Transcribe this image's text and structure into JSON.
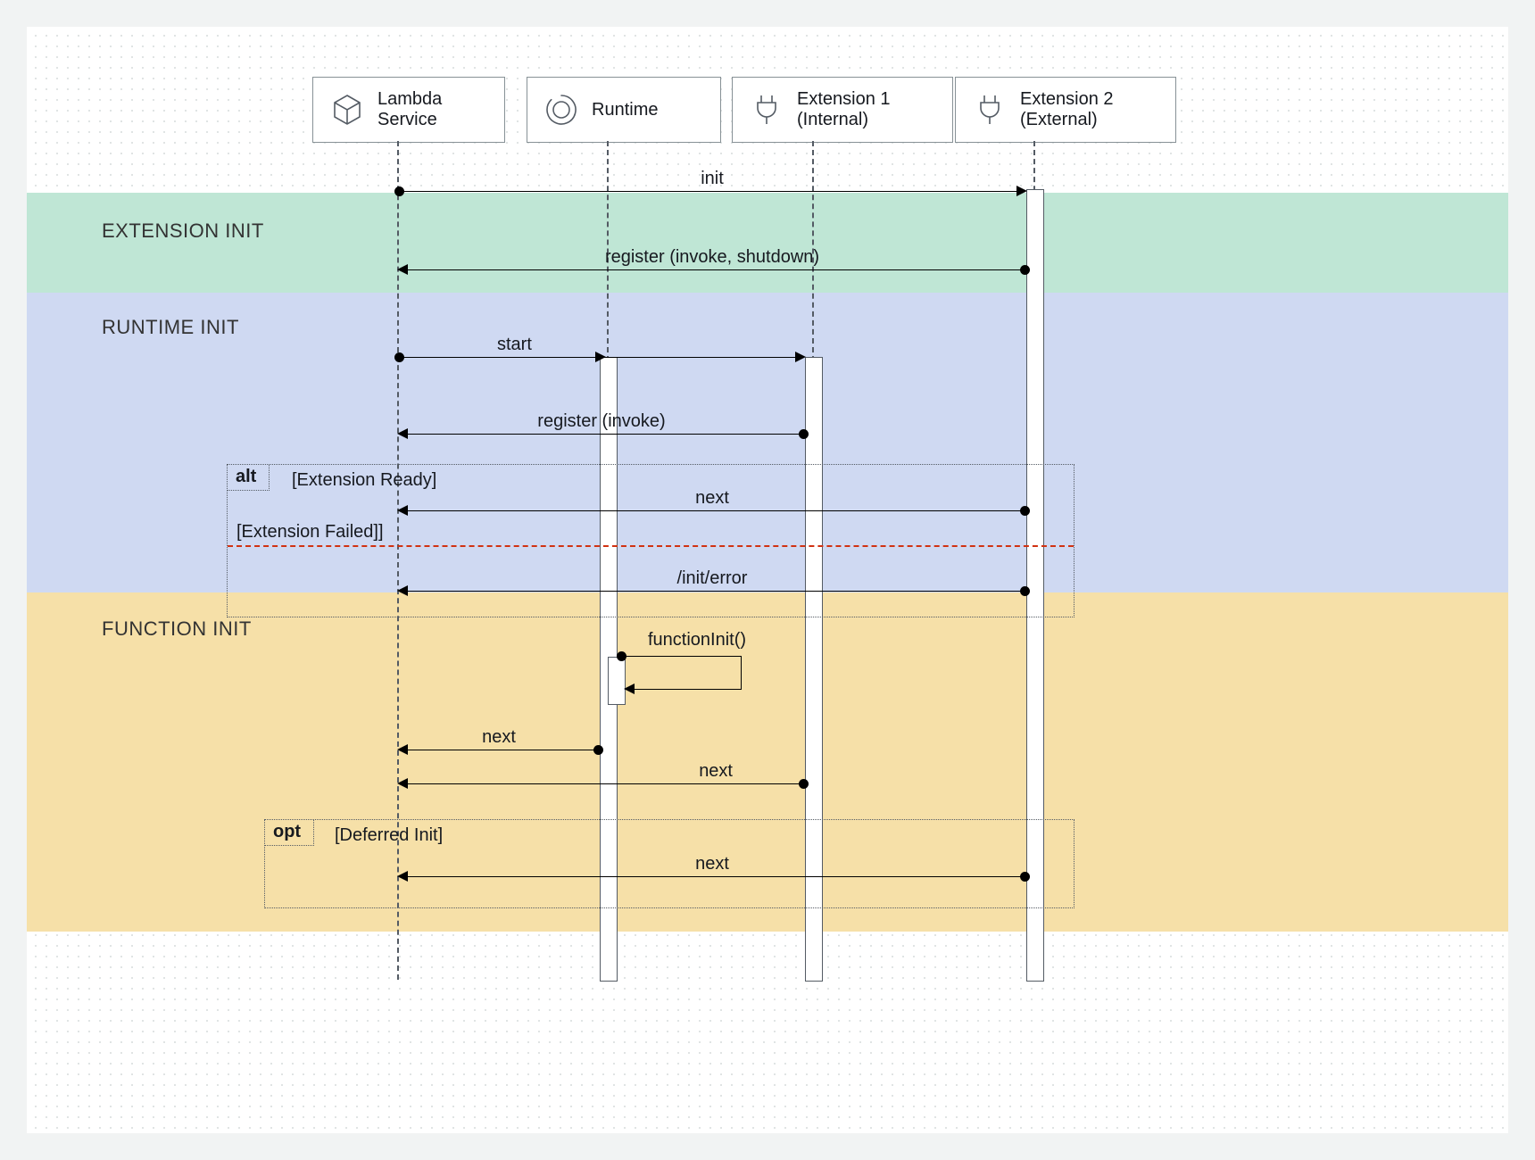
{
  "participants": {
    "lambda": "Lambda\nService",
    "runtime": "Runtime",
    "ext1": "Extension 1\n(Internal)",
    "ext2": "Extension 2\n(External)"
  },
  "phases": {
    "extension": "EXTENSION INIT",
    "runtime": "RUNTIME INIT",
    "function": "FUNCTION INIT"
  },
  "messages": {
    "init": "init",
    "register_ext2": "register (invoke, shutdown)",
    "start": "start",
    "register_ext1": "register (invoke)",
    "next_ext2": "next",
    "init_error": "/init/error",
    "functionInit": "functionInit()",
    "next_runtime": "next",
    "next_ext1": "next",
    "next_deferred": "next"
  },
  "fragments": {
    "alt": "alt",
    "alt_ready": "[Extension Ready]",
    "alt_failed": "[Extension Failed]]",
    "opt": "opt",
    "opt_guard": "[Deferred Init]"
  }
}
